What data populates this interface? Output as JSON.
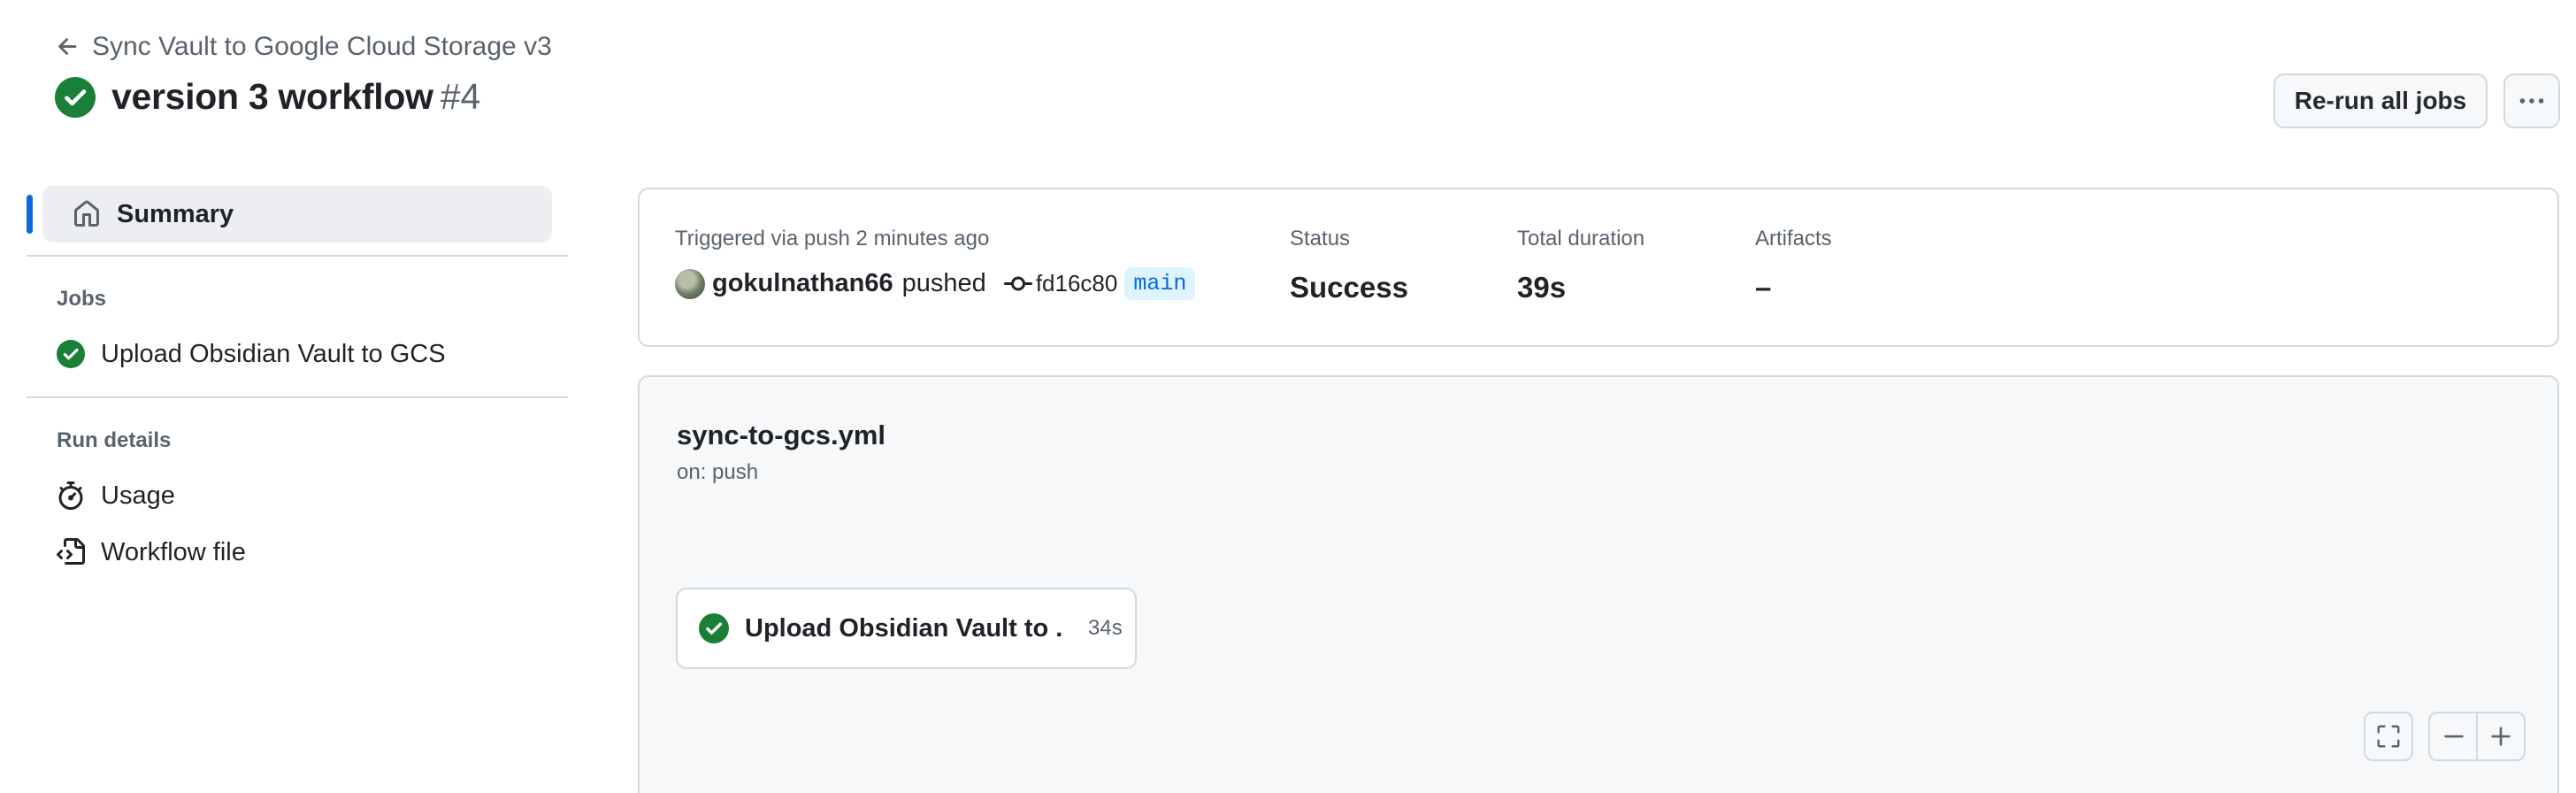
{
  "header": {
    "back_link": "Sync Vault to Google Cloud Storage v3",
    "run_title": "version 3 workflow",
    "run_number": "#4",
    "rerun_label": "Re-run all jobs"
  },
  "sidebar": {
    "summary_label": "Summary",
    "jobs_heading": "Jobs",
    "jobs": [
      {
        "label": "Upload Obsidian Vault to GCS",
        "status": "success"
      }
    ],
    "run_details_heading": "Run details",
    "run_details": [
      {
        "label": "Usage",
        "icon": "stopwatch-icon"
      },
      {
        "label": "Workflow file",
        "icon": "file-code-icon"
      }
    ]
  },
  "summary": {
    "trigger_label": "Triggered via push 2 minutes ago",
    "actor": "gokulnathan66",
    "action": "pushed",
    "commit_sha": "fd16c80",
    "branch": "main",
    "status_label": "Status",
    "status_value": "Success",
    "duration_label": "Total duration",
    "duration_value": "39s",
    "artifacts_label": "Artifacts",
    "artifacts_value": "–"
  },
  "graph": {
    "workflow_file": "sync-to-gcs.yml",
    "trigger": "on: push",
    "job": {
      "name": "Upload Obsidian Vault to ...",
      "duration": "34s"
    }
  },
  "colors": {
    "success": "#1a7f37",
    "accent": "#0969da",
    "border": "#d1d9e0",
    "muted_text": "#59636e"
  }
}
